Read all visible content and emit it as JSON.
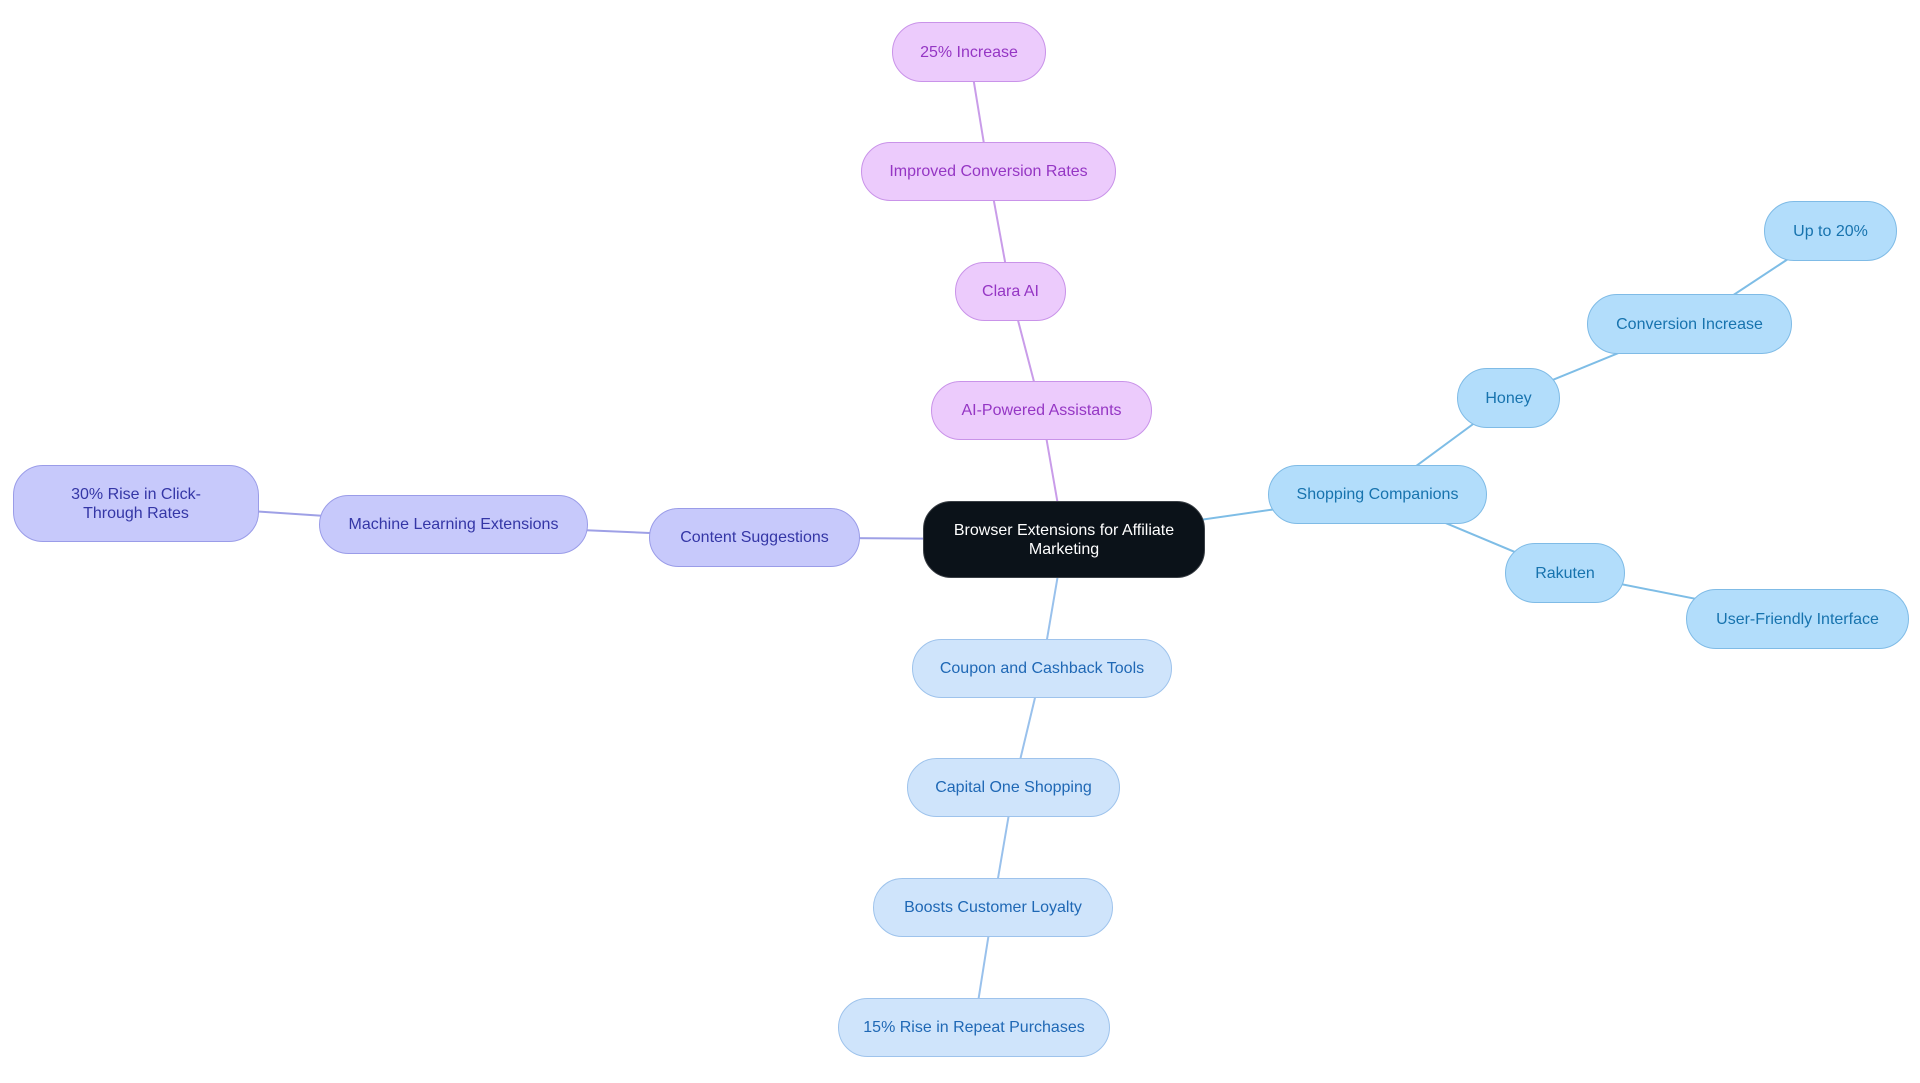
{
  "title": "Browser Extensions for Affiliate Marketing",
  "colors": {
    "root_fill": "#0b1219",
    "purple_edge": "#c99ce9",
    "indigo_edge": "#9ea0e6",
    "sky_edge": "#7ebde6",
    "pale_edge": "#99c1ec"
  },
  "nodes": {
    "root": "Browser Extensions for Affiliate Marketing",
    "ai_assistants": "AI-Powered Assistants",
    "clara_ai": "Clara AI",
    "improved_conversion": "Improved Conversion Rates",
    "increase_25": "25% Increase",
    "content_suggestions": "Content Suggestions",
    "ml_extensions": "Machine Learning Extensions",
    "rise_30": "30% Rise in Click-Through Rates",
    "shopping_companions": "Shopping Companions",
    "honey": "Honey",
    "conversion_increase": "Conversion Increase",
    "up_to_20": "Up to 20%",
    "rakuten": "Rakuten",
    "user_friendly": "User-Friendly Interface",
    "coupon_tools": "Coupon and Cashback Tools",
    "capital_one": "Capital One Shopping",
    "boosts_loyalty": "Boosts Customer Loyalty",
    "rise_15": "15% Rise in Repeat Purchases"
  },
  "edges": [
    {
      "from": "root",
      "to": "ai_assistants",
      "branch": "purple"
    },
    {
      "from": "ai_assistants",
      "to": "clara_ai",
      "branch": "purple"
    },
    {
      "from": "clara_ai",
      "to": "improved_conversion",
      "branch": "purple"
    },
    {
      "from": "improved_conversion",
      "to": "increase_25",
      "branch": "purple"
    },
    {
      "from": "root",
      "to": "content_suggestions",
      "branch": "indigo"
    },
    {
      "from": "content_suggestions",
      "to": "ml_extensions",
      "branch": "indigo"
    },
    {
      "from": "ml_extensions",
      "to": "rise_30",
      "branch": "indigo"
    },
    {
      "from": "root",
      "to": "shopping_companions",
      "branch": "sky"
    },
    {
      "from": "shopping_companions",
      "to": "honey",
      "branch": "sky"
    },
    {
      "from": "honey",
      "to": "conversion_increase",
      "branch": "sky"
    },
    {
      "from": "conversion_increase",
      "to": "up_to_20",
      "branch": "sky"
    },
    {
      "from": "shopping_companions",
      "to": "rakuten",
      "branch": "sky"
    },
    {
      "from": "rakuten",
      "to": "user_friendly",
      "branch": "sky"
    },
    {
      "from": "root",
      "to": "coupon_tools",
      "branch": "pale"
    },
    {
      "from": "coupon_tools",
      "to": "capital_one",
      "branch": "pale"
    },
    {
      "from": "capital_one",
      "to": "boosts_loyalty",
      "branch": "pale"
    },
    {
      "from": "boosts_loyalty",
      "to": "rise_15",
      "branch": "pale"
    }
  ]
}
